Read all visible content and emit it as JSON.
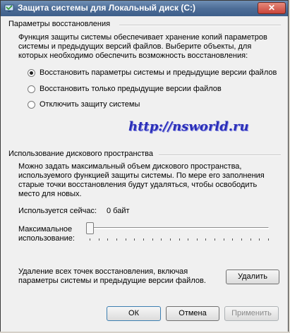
{
  "window": {
    "title": "Защита системы для Локальный диск (C:)",
    "close_glyph": "✕"
  },
  "restore": {
    "group_title": "Параметры восстановления",
    "description": "Функция защиты системы обеспечивает хранение копий параметров системы и предыдущих версий файлов. Выберите объекты, для которых необходимо обеспечить возможность восстановления:",
    "options": [
      {
        "label": "Восстановить параметры системы и предыдущие версии файлов",
        "selected": true
      },
      {
        "label": "Восстановить только предыдущие версии файлов",
        "selected": false
      },
      {
        "label": "Отключить защиту системы",
        "selected": false
      }
    ]
  },
  "watermark": "http://nsworld.ru",
  "disk_usage": {
    "group_title": "Использование дискового пространства",
    "description": "Можно задать максимальный объем дискового пространства, используемого функцией защиты системы. По мере его заполнения старые точки восстановления будут удаляться, чтобы освободить место для новых.",
    "current_label": "Используется сейчас:",
    "current_value": "0 байт",
    "max_label_line1": "Максимальное",
    "max_label_line2": "использование:",
    "slider_level": 0,
    "tick_count": 21
  },
  "delete": {
    "description_line1": "Удаление всех точек восстановления, включая",
    "description_line2": "параметры системы и предыдущие версии файлов.",
    "button_label": "Удалить"
  },
  "footer": {
    "ok_label": "ОК",
    "cancel_label": "Отмена",
    "apply_label": "Применить"
  },
  "colors": {
    "titlebar": "#4d6d97",
    "watermark": "#2b2fb8",
    "window_bg": "#f0f0f0"
  }
}
